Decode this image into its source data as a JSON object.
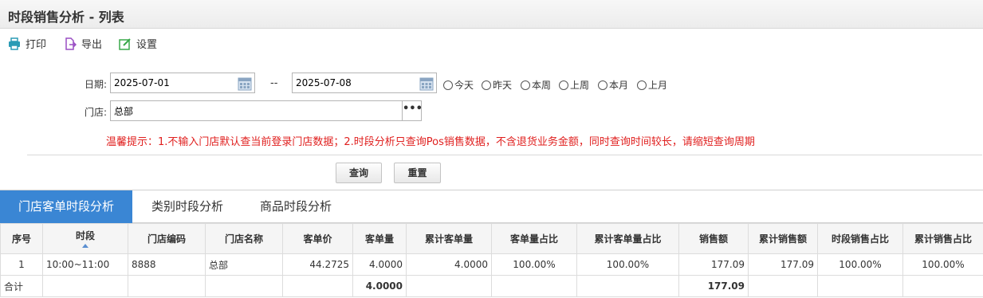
{
  "page": {
    "title": "时段销售分析 - 列表"
  },
  "toolbar": {
    "print_label": "打印",
    "export_label": "导出",
    "settings_label": "设置"
  },
  "filters": {
    "date_label": "日期:",
    "start_date": "2025-07-01",
    "date_separator": "--",
    "end_date": "2025-07-08",
    "quick_ranges": [
      "今天",
      "昨天",
      "本周",
      "上周",
      "本月",
      "上月"
    ],
    "store_label": "门店:",
    "store_value": "总部",
    "more_label": "•••"
  },
  "hint": "温馨提示：1.不输入门店默认查当前登录门店数据；2.时段分析只查询Pos销售数据，不含退货业务金额，同时查询时间较长，请缩短查询周期",
  "actions": {
    "query_label": "查询",
    "reset_label": "重置"
  },
  "tabs": [
    {
      "label": "门店客单时段分析",
      "active": true
    },
    {
      "label": "类别时段分析",
      "active": false
    },
    {
      "label": "商品时段分析",
      "active": false
    }
  ],
  "table": {
    "headers": [
      "序号",
      "时段",
      "门店编码",
      "门店名称",
      "客单价",
      "客单量",
      "累计客单量",
      "客单量占比",
      "累计客单量占比",
      "销售额",
      "累计销售额",
      "时段销售占比",
      "累计销售占比"
    ],
    "rows": [
      [
        "1",
        "10:00~11:00",
        "8888",
        "总部",
        "44.2725",
        "4.0000",
        "4.0000",
        "100.00%",
        "100.00%",
        "177.09",
        "177.09",
        "100.00%",
        "100.00%"
      ]
    ],
    "total": {
      "label": "合计",
      "customer_count": "4.0000",
      "sales": "177.09"
    }
  },
  "colors": {
    "accent": "#3a86d4",
    "hint": "#e0201f",
    "print_icon": "#2a9bb5",
    "export_icon": "#9a4fc4",
    "settings_icon": "#3aa84a"
  },
  "icons": {
    "print": "printer-icon",
    "export": "export-icon",
    "settings": "settings-icon",
    "calendar": "calendar-icon",
    "sort": "sort-ascending-icon"
  }
}
